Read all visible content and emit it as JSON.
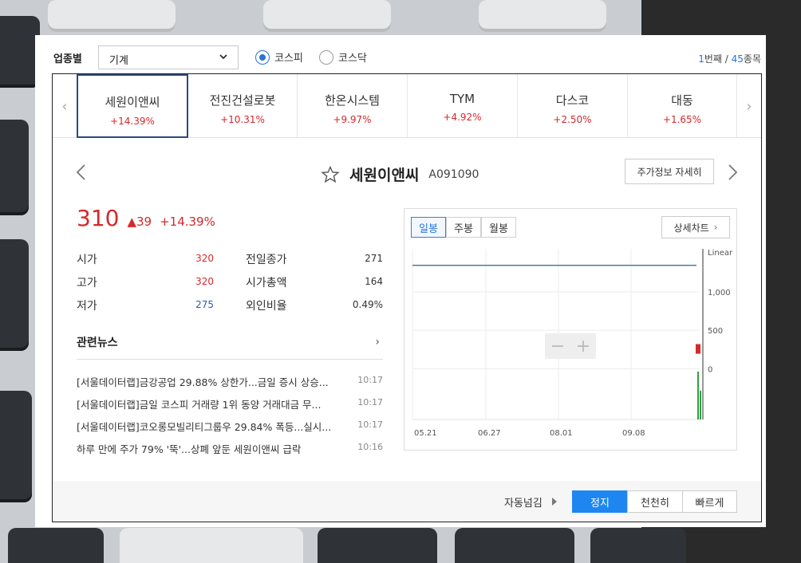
{
  "filter": {
    "label": "업종별",
    "selected": "기계",
    "markets": [
      "코스피",
      "코스닥"
    ],
    "selected_market": "코스피",
    "page_current": "1",
    "page_unit": "번째",
    "separator": "/",
    "page_total": "45",
    "total_unit": "종목"
  },
  "tabs": [
    {
      "name": "세원이앤씨",
      "rate": "+14.39%"
    },
    {
      "name": "전진건설로봇",
      "rate": "+10.31%"
    },
    {
      "name": "한온시스템",
      "rate": "+9.97%"
    },
    {
      "name": "TYM",
      "rate": "+4.92%"
    },
    {
      "name": "다스코",
      "rate": "+2.50%"
    },
    {
      "name": "대동",
      "rate": "+1.65%"
    }
  ],
  "stock": {
    "name": "세원이앤씨",
    "code": "A091090",
    "detail_button": "주가정보 자세히",
    "price": "310",
    "change": "▲39",
    "rate": "+14.39%",
    "stats": [
      {
        "label": "시가",
        "value": "320",
        "color": "red"
      },
      {
        "label": "고가",
        "value": "320",
        "color": "red"
      },
      {
        "label": "저가",
        "value": "275",
        "color": "blue"
      },
      {
        "label": "전일종가",
        "value": "271",
        "color": "plain"
      },
      {
        "label": "시가총액",
        "value": "164",
        "color": "plain"
      },
      {
        "label": "외인비율",
        "value": "0.49%",
        "color": "plain"
      }
    ]
  },
  "news": {
    "title": "관련뉴스",
    "items": [
      {
        "title": "[서울데이터랩]금강공업 29.88% 상한가...금일 증시 상승...",
        "time": "10:17"
      },
      {
        "title": "[서울데이터랩]금일 코스피 거래량 1위 동양 거래대금 무...",
        "time": "10:17"
      },
      {
        "title": "[서울데이터랩]코오롱모빌리티그룹우 29.84% 폭등...실시...",
        "time": "10:17"
      },
      {
        "title": "하루 만에 주가 79% '뚝'...상폐 앞둔 세원이앤씨 급락",
        "time": "10:16"
      }
    ]
  },
  "chart": {
    "tabs": [
      "일봉",
      "주봉",
      "월봉"
    ],
    "active_tab": "일봉",
    "detail_button": "상세차트",
    "scale_label": "Linear",
    "zoom_out": "−",
    "zoom_in": "+"
  },
  "chart_data": {
    "type": "line",
    "x_ticks": [
      "05.21",
      "06.27",
      "08.01",
      "09.08"
    ],
    "y_ticks": [
      "1,000",
      "500",
      "0"
    ],
    "series": [
      {
        "values": [
          1345,
          1345,
          1345,
          1345,
          1345
        ]
      }
    ],
    "ylim": [
      -660,
      1560
    ],
    "candle": {
      "open": 320,
      "high": 320,
      "low": 275,
      "close": 310
    },
    "grid": true,
    "scale": "linear"
  },
  "footer": {
    "auto_label": "자동넘김",
    "buttons": [
      "정지",
      "천천히",
      "빠르게"
    ],
    "active_button": "정지"
  },
  "colors": {
    "up": "#d6282a",
    "down": "#2a5ca8",
    "accent": "#1e86f0",
    "active_tab_border": "#2c4a7a",
    "line": "#2f5f8a",
    "volume": "#2ea043"
  }
}
